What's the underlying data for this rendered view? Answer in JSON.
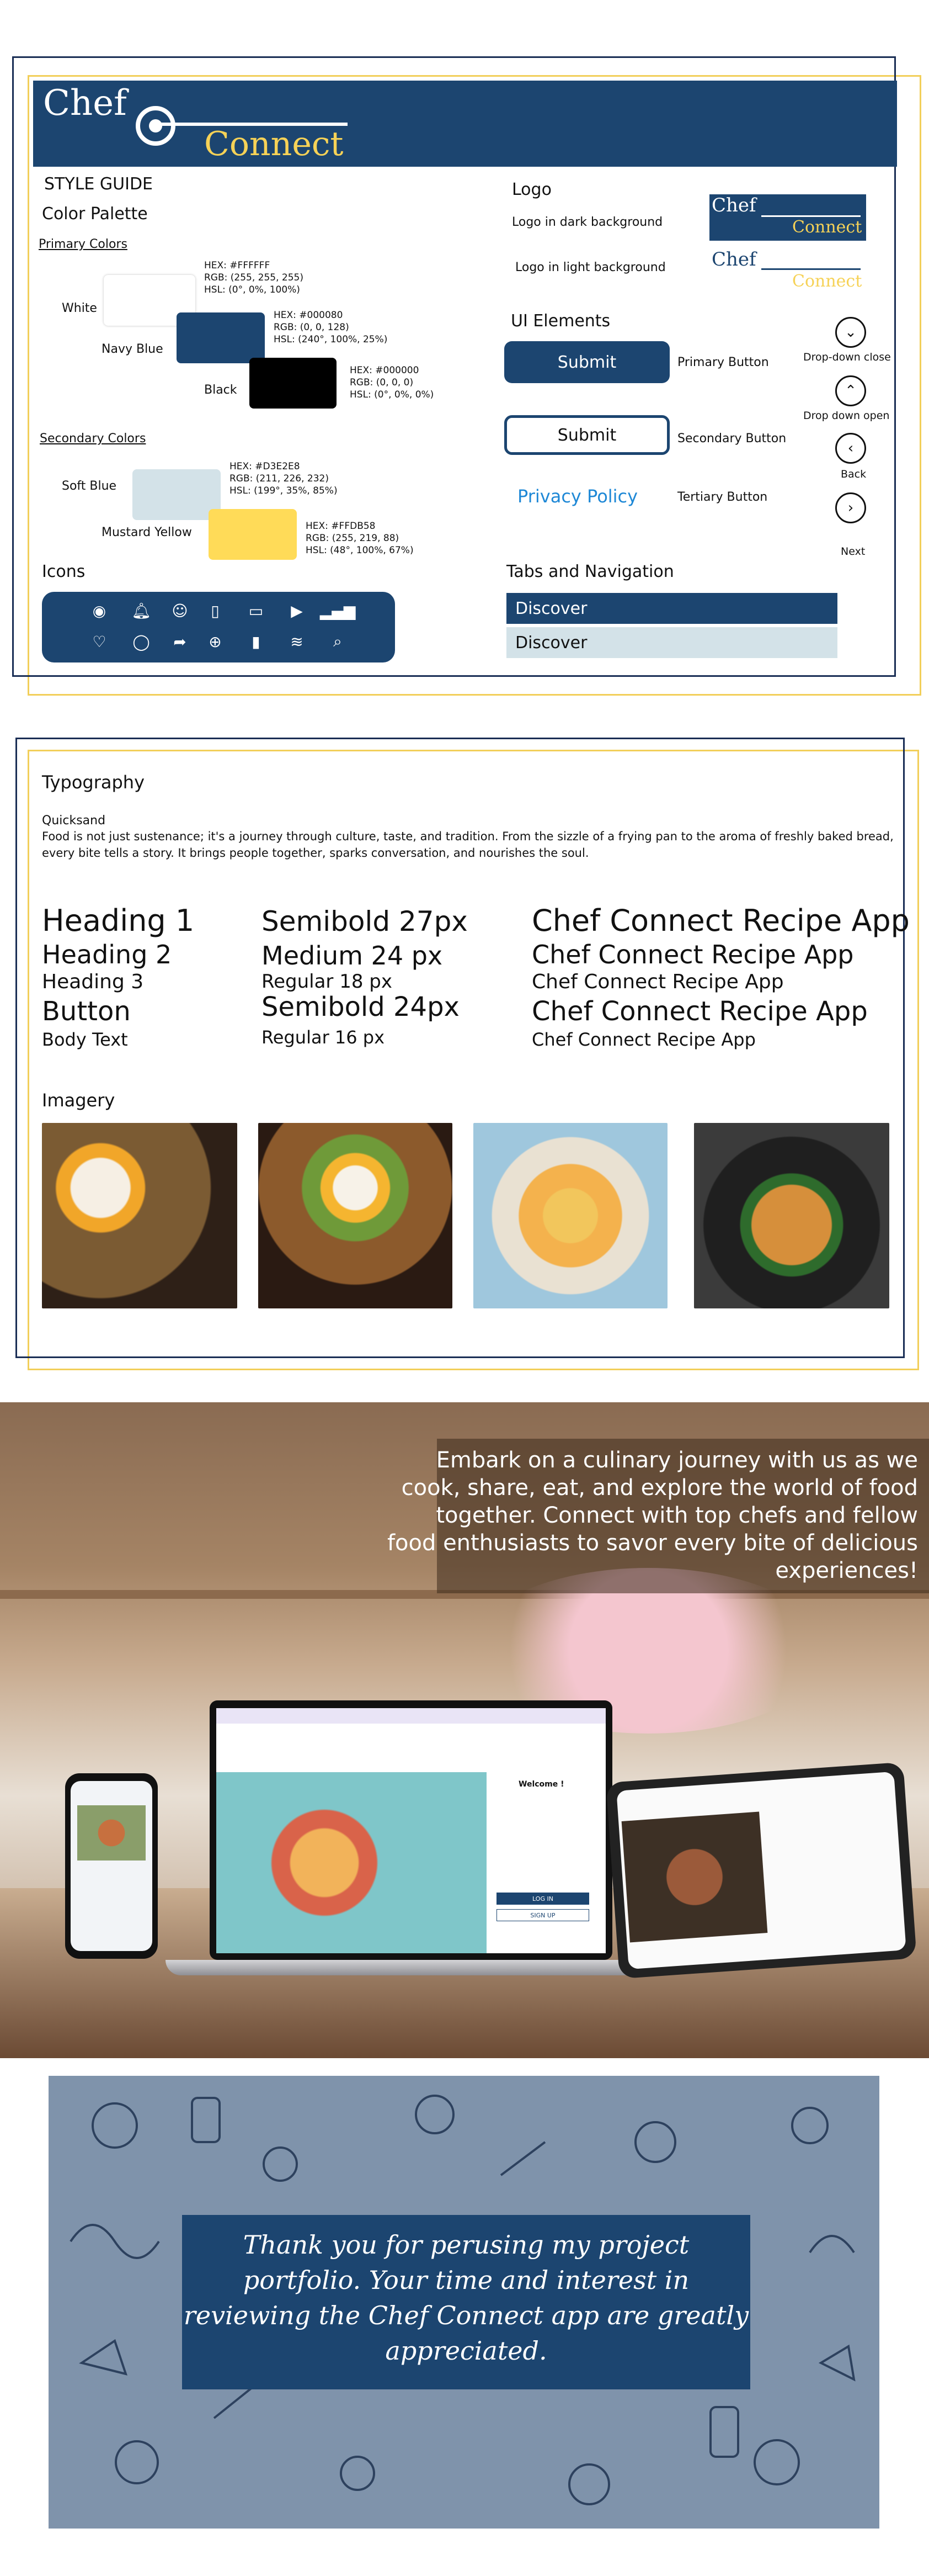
{
  "logo": {
    "chef": "Chef",
    "connect": "Connect"
  },
  "style_guide": {
    "title": "STYLE GUIDE",
    "color_palette": "Color Palette",
    "primary_colors_label": "Primary Colors",
    "secondary_colors_label": "Secondary Colors",
    "colors": [
      {
        "name": "White",
        "hex": "HEX: #FFFFFF",
        "rgb": "RGB: (255, 255, 255)",
        "hsl": "HSL: (0°, 0%, 100%)",
        "color": "#FFFFFF"
      },
      {
        "name": "Navy Blue",
        "hex": "HEX: #000080",
        "rgb": "RGB: (0, 0, 128)",
        "hsl": "HSL: (240°, 100%, 25%)",
        "color": "#1c4570"
      },
      {
        "name": "Black",
        "hex": "HEX: #000000",
        "rgb": "RGB: (0, 0, 0)",
        "hsl": "HSL: (0°, 0%, 0%)",
        "color": "#000000"
      },
      {
        "name": "Soft Blue",
        "hex": "HEX: #D3E2E8",
        "rgb": "RGB: (211, 226, 232)",
        "hsl": "HSL: (199°, 35%, 85%)",
        "color": "#D3E2E8"
      },
      {
        "name": "Mustard Yellow",
        "hex": "HEX: #FFDB58",
        "rgb": "RGB: (255, 219, 88)",
        "hsl": "HSL: (48°, 100%, 67%)",
        "color": "#FFDB58"
      }
    ],
    "icons_title": "Icons",
    "logo_title": "Logo",
    "logo_dark": "Logo in dark background",
    "logo_light": "Logo in light background",
    "ui_title": "UI Elements",
    "submit": "Submit",
    "primary_button": "Primary Button",
    "secondary_button": "Secondary Button",
    "privacy_policy": "Privacy Policy",
    "tertiary_button": "Tertiary Button",
    "dropdown_close": "Drop-down close",
    "dropdown_open": "Drop down open",
    "back": "Back",
    "next": "Next",
    "tabs_title": "Tabs and Navigation",
    "discover": "Discover"
  },
  "typography": {
    "title": "Typography",
    "font_name": "Quicksand",
    "sample": "Food is not just sustenance; it's a journey through culture, taste, and tradition. From the sizzle of a frying pan to the aroma of freshly baked bread, every bite tells a story. It brings people together, sparks conversation, and nourishes the soul.",
    "col1": [
      "Heading 1",
      "Heading 2",
      "Heading 3",
      "Button",
      "Body Text"
    ],
    "col2": [
      "Semibold 27px",
      "Medium 24 px",
      "Regular 18 px",
      "Semibold 24px",
      "Regular 16 px"
    ],
    "col3": [
      "Chef Connect Recipe App",
      "Chef Connect Recipe App",
      "Chef Connect Recipe App",
      "Chef Connect Recipe App",
      "Chef Connect Recipe App"
    ]
  },
  "imagery": {
    "title": "Imagery"
  },
  "banner": {
    "text": "Embark on a culinary journey with us as we cook, share, eat, and explore the world of food together. Connect with top chefs and fellow food enthusiasts to savor every bite of delicious experiences!",
    "welcome": "Welcome !",
    "login": "LOG IN",
    "signup": "SIGN UP"
  },
  "footer": {
    "text": "Thank you for perusing my project portfolio. Your time and interest in reviewing the Chef Connect app are greatly appreciated."
  }
}
